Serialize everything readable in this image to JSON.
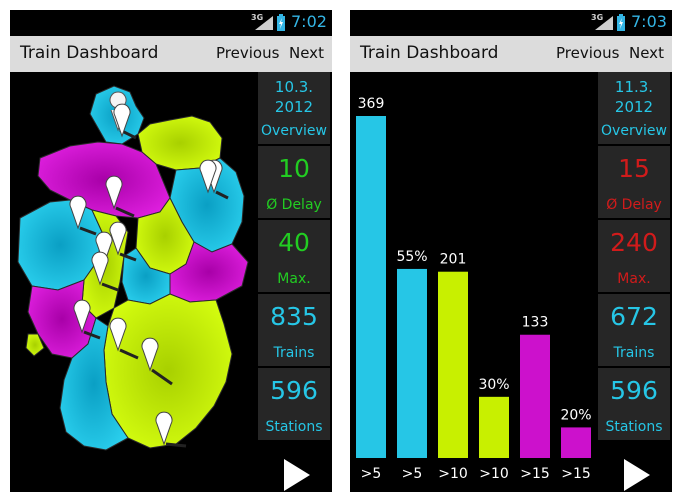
{
  "colors": {
    "cyan": "#26c6e6",
    "lime": "#c8f000",
    "magenta": "#cc11cc",
    "green": "#22cc22",
    "red": "#d11b1b",
    "tile": "#262626"
  },
  "left": {
    "status": {
      "network": "3G",
      "time": "7:02"
    },
    "title": "Train Dashboard",
    "prev": "Previous",
    "next": "Next",
    "date": "10.3.\n2012",
    "overview": "Overview",
    "delay": {
      "value": "10",
      "label": "Ø Delay"
    },
    "max": {
      "value": "40",
      "label": "Max."
    },
    "trains": {
      "value": "835",
      "label": "Trains"
    },
    "stations": {
      "value": "596",
      "label": "Stations"
    },
    "map_icon": "germany-map",
    "pin_icon": "map-pin-icon",
    "play_icon": "play-icon"
  },
  "right": {
    "status": {
      "network": "3G",
      "time": "7:03"
    },
    "title": "Train Dashboard",
    "prev": "Previous",
    "next": "Next",
    "date": "11.3.\n2012",
    "overview": "Overview",
    "delay": {
      "value": "15",
      "label": "Ø Delay"
    },
    "max": {
      "value": "240",
      "label": "Max."
    },
    "trains": {
      "value": "672",
      "label": "Trains"
    },
    "stations": {
      "value": "596",
      "label": "Stations"
    },
    "play_icon": "play-icon"
  },
  "chart_data": {
    "type": "bar",
    "categories": [
      ">5",
      ">5",
      ">10",
      ">10",
      ">15",
      ">15"
    ],
    "values": [
      369,
      204,
      201,
      66,
      133,
      33
    ],
    "labels": [
      "369",
      "55%",
      "201",
      "30%",
      "133",
      "20%"
    ],
    "colors": [
      "#26c6e6",
      "#26c6e6",
      "#c8f000",
      "#c8f000",
      "#cc11cc",
      "#cc11cc"
    ],
    "ylim": [
      0,
      410
    ]
  }
}
